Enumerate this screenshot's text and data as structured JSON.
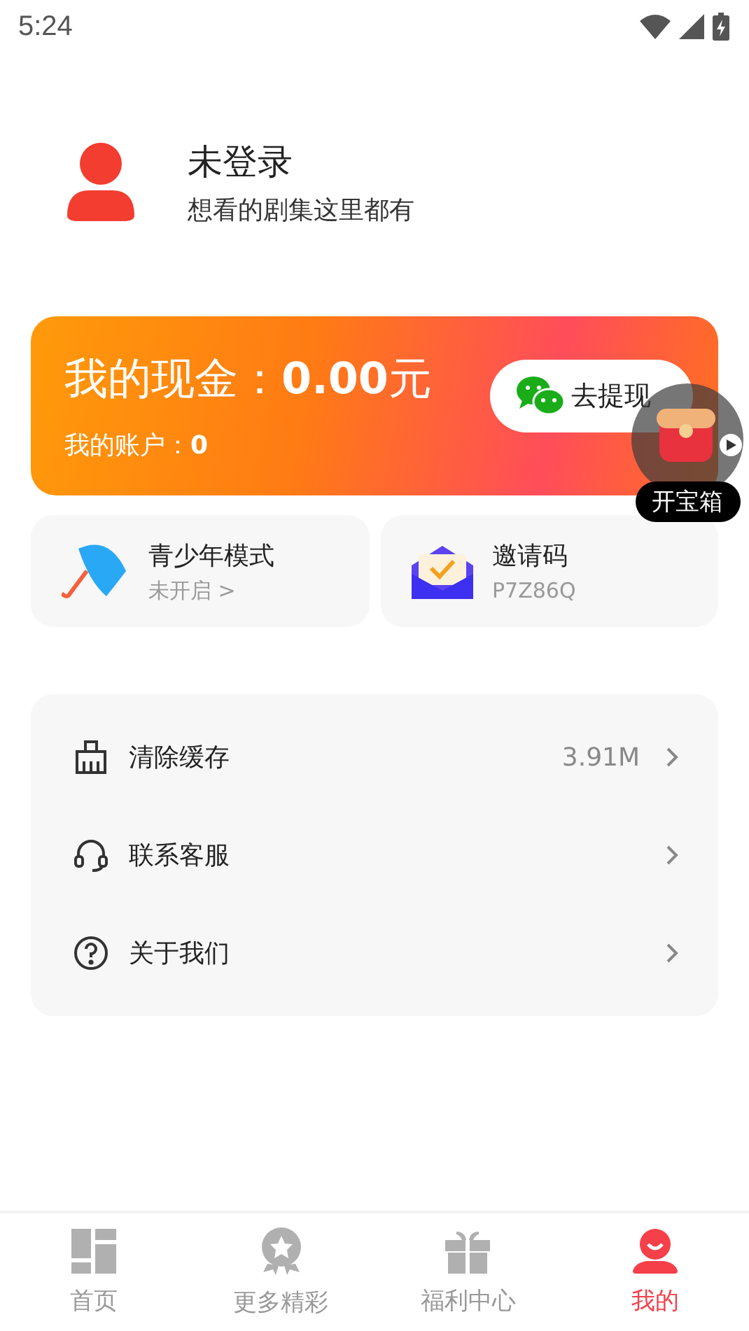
{
  "status_bar": {
    "time": "5:24"
  },
  "profile": {
    "title": "未登录",
    "subtitle": "想看的剧集这里都有"
  },
  "cash_card": {
    "cash": "我的现金：**0.00**元",
    "account": "我的账户：**0**",
    "button": "去提现"
  },
  "treasure": {
    "label": "开宝箱"
  },
  "tiles": [
    {
      "kind": "umbrella",
      "title": "青少年模式",
      "subtitle": "未开启 >"
    },
    {
      "kind": "envelope",
      "title": "邀请码",
      "subtitle": "P7Z86Q"
    }
  ],
  "menu": [
    {
      "kind": "broom",
      "label": "清除缓存",
      "value": "3.91M"
    },
    {
      "kind": "headset",
      "label": "联系客服"
    },
    {
      "kind": "question",
      "label": "关于我们"
    }
  ],
  "tabs": [
    {
      "kind": "home",
      "label": "首页",
      "selected": false
    },
    {
      "kind": "medal",
      "label": "更多精彩",
      "selected": false
    },
    {
      "kind": "gift",
      "label": "福利中心",
      "selected": false
    },
    {
      "kind": "user",
      "label": "我的",
      "selected": true
    }
  ]
}
